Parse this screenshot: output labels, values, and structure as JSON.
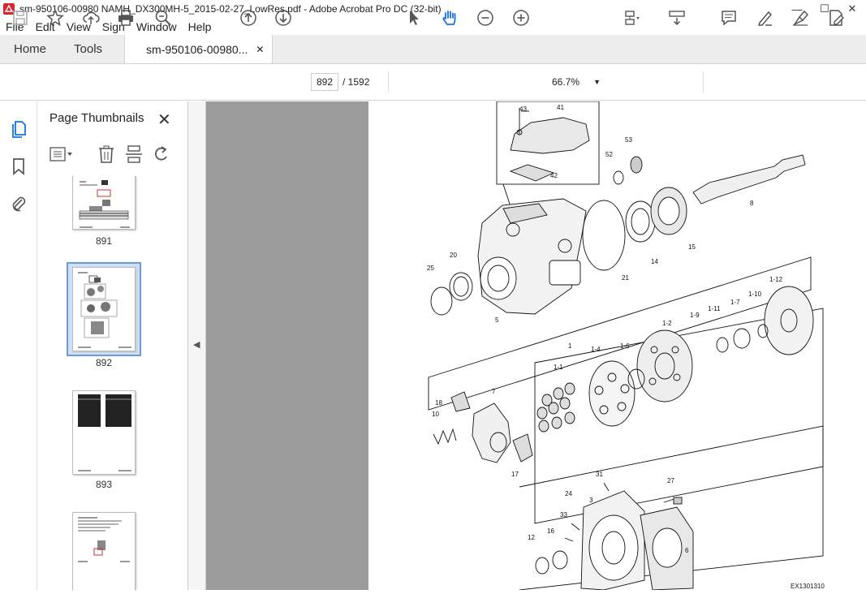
{
  "window": {
    "title": "sm-950106-00980 NAMH_DX300MH-5_2015-02-27_LowRes.pdf - Adobe Acrobat Pro DC (32-bit)",
    "minimize": "—",
    "maximize": "☐",
    "close": "✕"
  },
  "menu": [
    "File",
    "Edit",
    "View",
    "Sign",
    "Window",
    "Help"
  ],
  "tabs": {
    "home": "Home",
    "tools": "Tools",
    "document": "sm-950106-00980...",
    "document_close": "✕"
  },
  "toolbar": {
    "current_page": "892",
    "page_total": "/ 1592",
    "zoom": "66.7%"
  },
  "panel": {
    "title": "Page Thumbnails",
    "close": "✕",
    "thumbnails": [
      {
        "label": "891"
      },
      {
        "label": "892"
      },
      {
        "label": "893"
      },
      {
        "label": ""
      }
    ]
  },
  "drawing": {
    "figure_id": "EX1301310",
    "callouts": [
      "43",
      "41",
      "42",
      "53",
      "52",
      "8",
      "15",
      "14",
      "21",
      "20",
      "25",
      "5",
      "1-12",
      "1-10",
      "1-7",
      "1-11",
      "1-9",
      "1-2",
      "1",
      "1-4",
      "1-6",
      "1-1",
      "7",
      "18",
      "10",
      "17",
      "31",
      "27",
      "24",
      "3",
      "33",
      "12",
      "16",
      "6"
    ]
  }
}
